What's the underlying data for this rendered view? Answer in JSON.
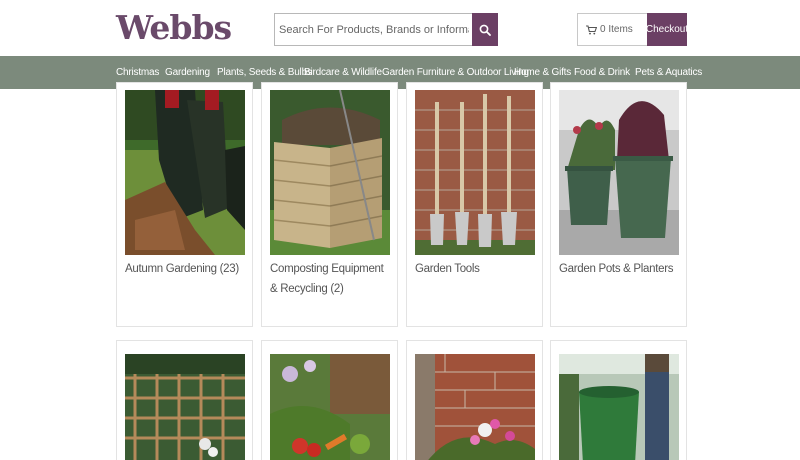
{
  "header": {
    "logo": "Webbs",
    "search_placeholder": "Search For Products, Brands or Information",
    "cart_label": "0 Items",
    "checkout_label": "Checkout"
  },
  "nav": {
    "items": [
      "Christmas",
      "Gardening",
      "Plants, Seeds & Bulbs",
      "Birdcare & Wildlife",
      "Garden Furniture & Outdoor Living",
      "Home & Gifts",
      "Food & Drink",
      "Pets & Aquatics"
    ]
  },
  "categories": [
    {
      "label": "Autumn Gardening (23)"
    },
    {
      "label": "Composting Equipment & Recycling (2)"
    },
    {
      "label": "Garden Tools"
    },
    {
      "label": "Garden Pots & Planters"
    }
  ],
  "colors": {
    "brand_purple": "#6b3f64",
    "nav_green": "#7c8a7c"
  }
}
